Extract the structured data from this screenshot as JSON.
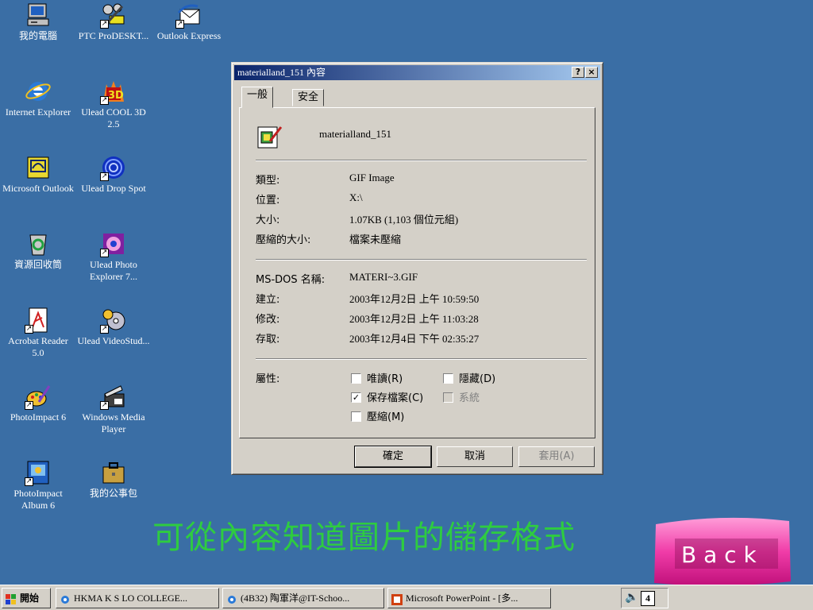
{
  "desktop": {
    "icons": [
      {
        "label": "我的電腦"
      },
      {
        "label": "PTC ProDESKT..."
      },
      {
        "label": "Outlook Express"
      },
      {
        "label": "Internet Explorer"
      },
      {
        "label": "Ulead COOL 3D 2.5"
      },
      {
        "label": "Microsoft Outlook"
      },
      {
        "label": "Ulead Drop Spot"
      },
      {
        "label": "資源回收筒"
      },
      {
        "label": "Ulead Photo Explorer 7..."
      },
      {
        "label": "Acrobat Reader 5.0"
      },
      {
        "label": "Ulead VideoStud..."
      },
      {
        "label": "PhotoImpact 6"
      },
      {
        "label": "Windows Media Player"
      },
      {
        "label": "PhotoImpact Album 6"
      },
      {
        "label": "我的公事包"
      }
    ]
  },
  "dialog": {
    "title": "materialland_151 內容",
    "help_btn": "?",
    "close_btn": "×",
    "tabs": [
      {
        "label": "一般"
      },
      {
        "label": "安全"
      }
    ],
    "file_name": "materialland_151",
    "rows1": [
      {
        "label": "類型:",
        "value": "GIF Image"
      },
      {
        "label": "位置:",
        "value": "X:\\"
      },
      {
        "label": "大小:",
        "value": "1.07KB (1,103 個位元組)"
      },
      {
        "label": "壓縮的大小:",
        "value": "檔案未壓縮"
      }
    ],
    "rows2": [
      {
        "label": "MS-DOS 名稱:",
        "value": "MATERI~3.GIF"
      },
      {
        "label": "建立:",
        "value": "2003年12月2日 上午 10:59:50"
      },
      {
        "label": "修改:",
        "value": "2003年12月2日 上午 11:03:28"
      },
      {
        "label": "存取:",
        "value": "2003年12月4日 下午 02:35:27"
      }
    ],
    "attributes_label": "屬性:",
    "attributes": [
      {
        "label": "唯讀(R)",
        "checked": false,
        "enabled": true
      },
      {
        "label": "隱藏(D)",
        "checked": false,
        "enabled": true
      },
      {
        "label": "保存檔案(C)",
        "checked": true,
        "enabled": true
      },
      {
        "label": "系統",
        "checked": false,
        "enabled": false
      },
      {
        "label": "壓縮(M)",
        "checked": false,
        "enabled": true
      }
    ],
    "buttons": {
      "ok": "確定",
      "cancel": "取消",
      "apply": "套用(A)"
    }
  },
  "caption": "可從內容知道圖片的儲存格式",
  "back_button": "B a c k",
  "taskbar": {
    "start": "開始",
    "items": [
      {
        "label": "HKMA K S LO COLLEGE..."
      },
      {
        "label": "(4B32) 陶軍洋@IT-Schoo..."
      },
      {
        "label": "Microsoft PowerPoint - [多..."
      }
    ],
    "tray_value": "4"
  }
}
